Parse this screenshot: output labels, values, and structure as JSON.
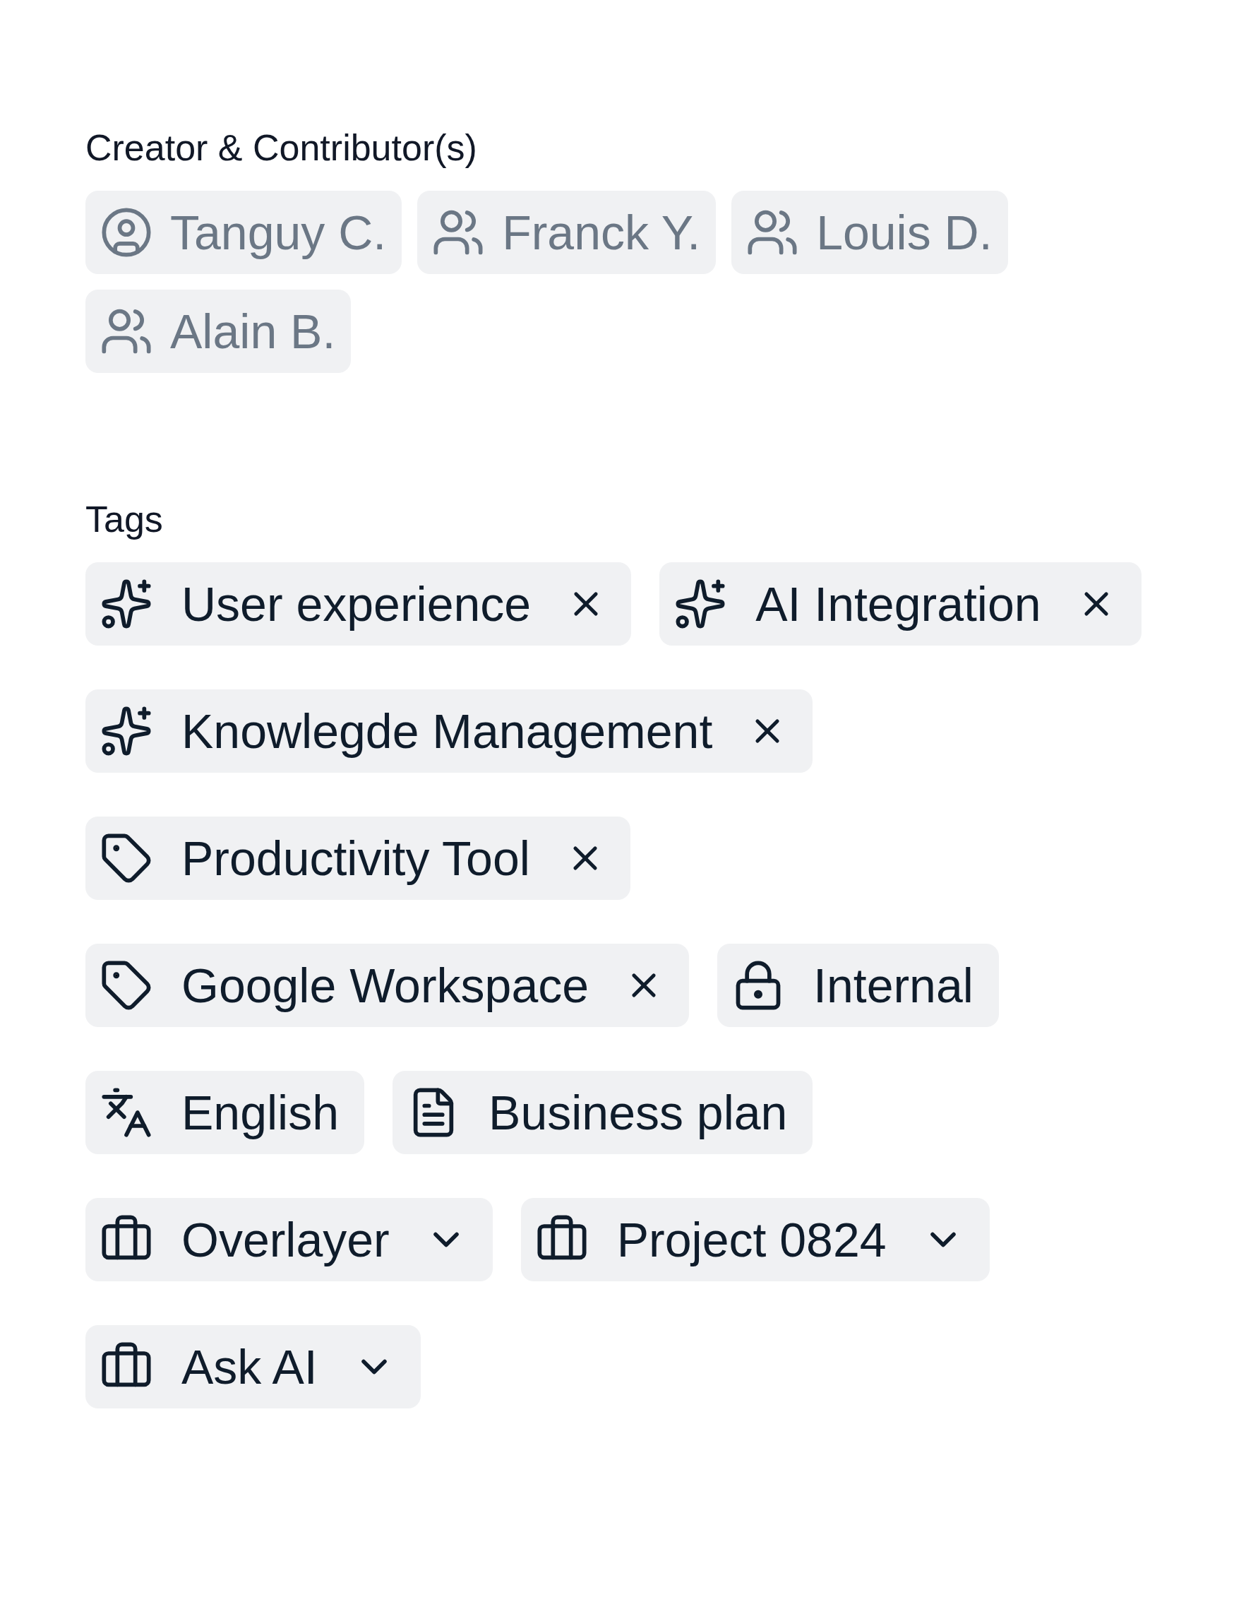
{
  "contributors": {
    "heading": "Creator & Contributor(s)",
    "people": [
      {
        "name": "Tanguy C.",
        "kind": "creator"
      },
      {
        "name": "Franck Y.",
        "kind": "contributor"
      },
      {
        "name": "Louis D.",
        "kind": "contributor"
      },
      {
        "name": "Alain B.",
        "kind": "contributor"
      }
    ]
  },
  "tags": {
    "heading": "Tags",
    "items": [
      {
        "label": "User experience",
        "kind": "ai"
      },
      {
        "label": "AI Integration",
        "kind": "ai"
      },
      {
        "label": "Knowlegde Management",
        "kind": "ai"
      },
      {
        "label": "Productivity Tool",
        "kind": "tag"
      },
      {
        "label": "Google Workspace",
        "kind": "tag"
      },
      {
        "label": "Internal",
        "kind": "access"
      },
      {
        "label": "English",
        "kind": "language"
      },
      {
        "label": "Business plan",
        "kind": "doctype"
      },
      {
        "label": "Overlayer",
        "kind": "project"
      },
      {
        "label": "Project 0824",
        "kind": "project"
      },
      {
        "label": "Ask AI",
        "kind": "project"
      }
    ]
  }
}
